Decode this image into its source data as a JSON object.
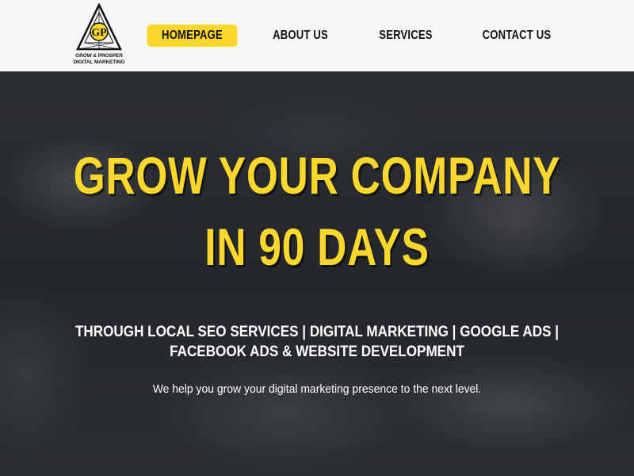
{
  "header": {
    "logo": {
      "initials": "GP",
      "line1": "GROW & PROSPER",
      "line2": "DIGITAL MARKETING",
      "accent": "#fdd72b"
    },
    "nav": [
      {
        "label": "HOMEPAGE",
        "active": true
      },
      {
        "label": "ABOUT US",
        "active": false
      },
      {
        "label": "SERVICES",
        "active": false
      },
      {
        "label": "CONTACT US",
        "active": false
      }
    ]
  },
  "hero": {
    "title_line1": "GROW YOUR COMPANY",
    "title_line2": "IN 90 DAYS",
    "subtitle": "THROUGH LOCAL SEO SERVICES | DIGITAL MARKETING | GOOGLE ADS | FACEBOOK ADS & WEBSITE DEVELOPMENT",
    "description": "We help you grow your digital marketing presence to the next level."
  },
  "colors": {
    "accent": "#fdd72b",
    "header_bg": "#f7f7f7",
    "hero_bg": "#26292d",
    "text_light": "#ffffff"
  }
}
